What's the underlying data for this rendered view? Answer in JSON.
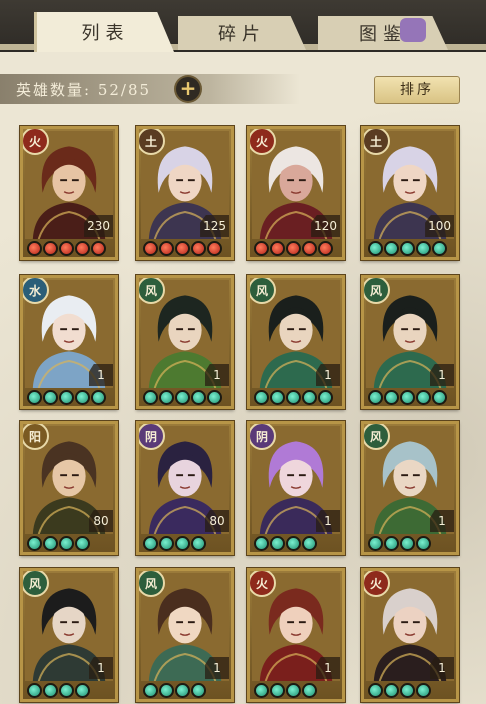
{
  "tabs": [
    {
      "label": "列表",
      "active": true
    },
    {
      "label": "碎片",
      "active": false
    },
    {
      "label": "图鉴",
      "active": false
    }
  ],
  "roster": {
    "label": "英雄数量:",
    "count": "52/85",
    "add_icon": "plus-icon"
  },
  "sort_label": "排序",
  "colors": {
    "red_gem": "#c8321e",
    "teal_gem": "#2fb88e",
    "card_frame": "#b79547"
  },
  "heroes": [
    {
      "faction": "火",
      "faction_type": "fire",
      "level": "230",
      "stars": 5,
      "star_color": "red",
      "hair": "#6a2a1a",
      "outfit": "#4a1e18",
      "skin": "#e7c4a4"
    },
    {
      "faction": "土",
      "faction_type": "earth",
      "level": "125",
      "stars": 5,
      "star_color": "red",
      "hair": "#d8d3e6",
      "outfit": "#3d3550",
      "skin": "#efd6c4"
    },
    {
      "faction": "火",
      "faction_type": "fire",
      "level": "120",
      "stars": 5,
      "star_color": "red",
      "hair": "#ece6e2",
      "outfit": "#6a1f22",
      "skin": "#d9a89a"
    },
    {
      "faction": "土",
      "faction_type": "earth",
      "level": "100",
      "stars": 5,
      "star_color": "teal",
      "hair": "#d8d3e6",
      "outfit": "#3d3550",
      "skin": "#efd6c4"
    },
    {
      "faction": "水",
      "faction_type": "water",
      "level": "1",
      "stars": 5,
      "star_color": "teal",
      "hair": "#e9edf2",
      "outfit": "#7da4c6",
      "skin": "#f1ddd0"
    },
    {
      "faction": "风",
      "faction_type": "wind",
      "level": "1",
      "stars": 5,
      "star_color": "teal",
      "hair": "#1d2620",
      "outfit": "#4d7a30",
      "skin": "#e9d5bf"
    },
    {
      "faction": "风",
      "faction_type": "wind",
      "level": "1",
      "stars": 5,
      "star_color": "teal",
      "hair": "#1a1f1c",
      "outfit": "#2d6a4e",
      "skin": "#e9d5bf"
    },
    {
      "faction": "风",
      "faction_type": "wind",
      "level": "1",
      "stars": 5,
      "star_color": "teal",
      "hair": "#1a1f1c",
      "outfit": "#2d6a4e",
      "skin": "#e9d5bf"
    },
    {
      "faction": "阳",
      "faction_type": "yang",
      "level": "80",
      "stars": 4,
      "star_color": "teal",
      "hair": "#4a3322",
      "outfit": "#3b3a1e",
      "skin": "#e6c7a6"
    },
    {
      "faction": "阴",
      "faction_type": "yin",
      "level": "80",
      "stars": 4,
      "star_color": "teal",
      "hair": "#2a2240",
      "outfit": "#3a2a5e",
      "skin": "#e8d4de"
    },
    {
      "faction": "阴",
      "faction_type": "yin",
      "level": "1",
      "stars": 4,
      "star_color": "teal",
      "hair": "#b07ad6",
      "outfit": "#3a2a5a",
      "skin": "#efd6dc"
    },
    {
      "faction": "风",
      "faction_type": "wind",
      "level": "1",
      "stars": 4,
      "star_color": "teal",
      "hair": "#a7c2c9",
      "outfit": "#3d6a34",
      "skin": "#ead7c4"
    },
    {
      "faction": "风",
      "faction_type": "wind",
      "level": "1",
      "stars": 4,
      "star_color": "teal",
      "hair": "#1c1c1c",
      "outfit": "#2e3a34",
      "skin": "#e6d6c6"
    },
    {
      "faction": "风",
      "faction_type": "wind",
      "level": "1",
      "stars": 4,
      "star_color": "teal",
      "hair": "#4a2e1e",
      "outfit": "#3d6a54",
      "skin": "#f0d8c2"
    },
    {
      "faction": "火",
      "faction_type": "fire",
      "level": "1",
      "stars": 4,
      "star_color": "teal",
      "hair": "#7a2a1e",
      "outfit": "#7a1f1c",
      "skin": "#efd0bc"
    },
    {
      "faction": "火",
      "faction_type": "fire",
      "level": "1",
      "stars": 4,
      "star_color": "teal",
      "hair": "#d9d0cc",
      "outfit": "#2a1e1e",
      "skin": "#ecd2c2"
    }
  ]
}
